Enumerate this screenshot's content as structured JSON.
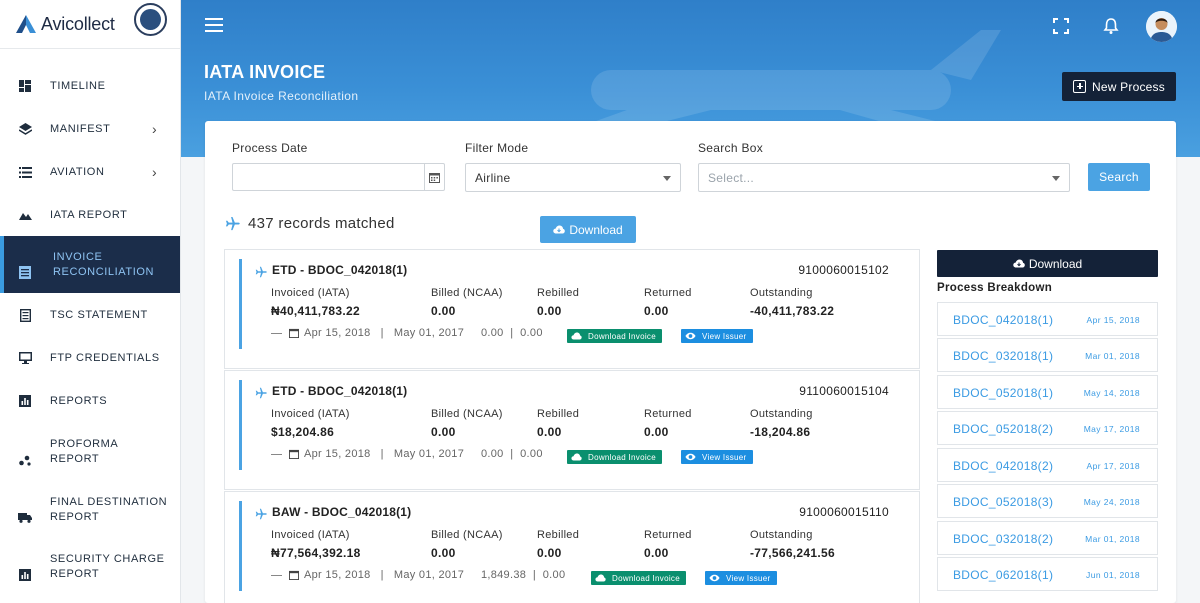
{
  "brand": {
    "name": "Avicollect"
  },
  "sidebar": {
    "items": [
      {
        "label": "TIMELINE",
        "icon": "dashboard-icon"
      },
      {
        "label": "MANIFEST",
        "icon": "layers-icon",
        "chevron": "›"
      },
      {
        "label": "AVIATION",
        "icon": "list-icon",
        "chevron": "›"
      },
      {
        "label": "IATA REPORT",
        "icon": "mountain-chart-icon"
      },
      {
        "label": "INVOICE RECONCILIATION",
        "icon": "invoice-icon",
        "active": true
      },
      {
        "label": "TSC STATEMENT",
        "icon": "document-icon"
      },
      {
        "label": "FTP CREDENTIALS",
        "icon": "monitor-icon"
      },
      {
        "label": "REPORTS",
        "icon": "bar-chart-icon"
      },
      {
        "label": "PROFORMA REPORT",
        "icon": "scatter-icon"
      },
      {
        "label": "FINAL DESTINATION REPORT",
        "icon": "truck-icon"
      },
      {
        "label": "SECURITY CHARGE REPORT",
        "icon": "bar-chart-icon"
      }
    ]
  },
  "header": {
    "title": "IATA INVOICE",
    "subtitle": "IATA Invoice Reconciliation",
    "new_process_label": "New Process"
  },
  "filters": {
    "process_date_label": "Process Date",
    "process_date_value": "",
    "filter_mode_label": "Filter Mode",
    "filter_mode_value": "Airline",
    "search_box_label": "Search Box",
    "search_placeholder": "Select...",
    "search_button": "Search"
  },
  "results": {
    "records_text": "437 records matched",
    "download_label": "Download"
  },
  "columns": [
    "Invoiced (IATA)",
    "Billed (NCAA)",
    "Rebilled",
    "Returned",
    "Outstanding"
  ],
  "records": [
    {
      "title": "ETD - BDOC_042018(1)",
      "number": "9100060015102",
      "invoiced": "₦40,411,783.22",
      "billed": "0.00",
      "rebilled": "0.00",
      "returned": "0.00",
      "outstanding": "-40,411,783.22",
      "date1": "Apr 15, 2018",
      "date2": "May 01, 2017",
      "amount1": "0.00",
      "amount2": "0.00",
      "download_invoice": "Download Invoice",
      "view_issuer": "View Issuer"
    },
    {
      "title": "ETD - BDOC_042018(1)",
      "number": "9110060015104",
      "invoiced": "$18,204.86",
      "billed": "0.00",
      "rebilled": "0.00",
      "returned": "0.00",
      "outstanding": "-18,204.86",
      "date1": "Apr 15, 2018",
      "date2": "May 01, 2017",
      "amount1": "0.00",
      "amount2": "0.00",
      "download_invoice": "Download Invoice",
      "view_issuer": "View Issuer"
    },
    {
      "title": "BAW - BDOC_042018(1)",
      "number": "9100060015110",
      "invoiced": "₦77,564,392.18",
      "billed": "0.00",
      "rebilled": "0.00",
      "returned": "0.00",
      "outstanding": "-77,566,241.56",
      "date1": "Apr 15, 2018",
      "date2": "May 01, 2017",
      "amount1": "1,849.38",
      "amount2": "0.00",
      "download_invoice": "Download Invoice",
      "view_issuer": "View Issuer"
    }
  ],
  "breakdown": {
    "download_label": "Download",
    "title": "Process Breakdown",
    "items": [
      {
        "name": "BDOC_042018(1)",
        "date": "Apr 15, 2018"
      },
      {
        "name": "BDOC_032018(1)",
        "date": "Mar 01, 2018"
      },
      {
        "name": "BDOC_052018(1)",
        "date": "May 14, 2018"
      },
      {
        "name": "BDOC_052018(2)",
        "date": "May 17, 2018"
      },
      {
        "name": "BDOC_042018(2)",
        "date": "Apr 17, 2018"
      },
      {
        "name": "BDOC_052018(3)",
        "date": "May 24, 2018"
      },
      {
        "name": "BDOC_032018(2)",
        "date": "Mar 01, 2018"
      },
      {
        "name": "BDOC_062018(1)",
        "date": "Jun 01, 2018"
      }
    ]
  },
  "colors": {
    "primary": "#3a8fd6",
    "navy": "#142238",
    "accent": "#4ba3e3",
    "green": "#0a8f6e"
  }
}
